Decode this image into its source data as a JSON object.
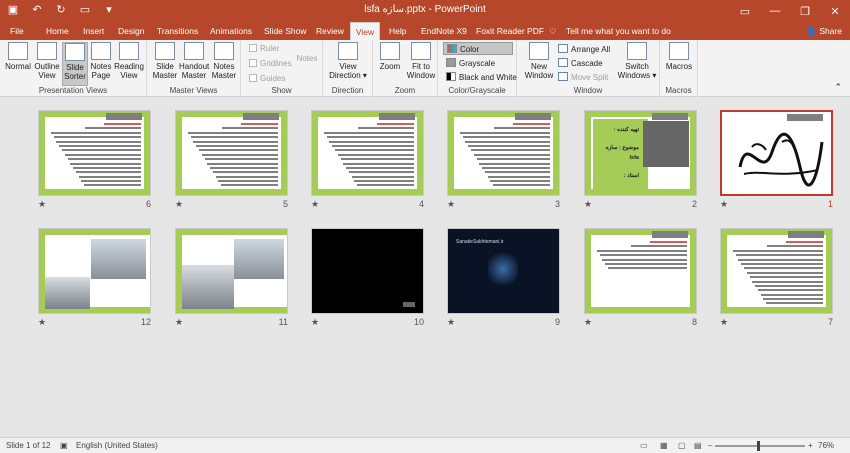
{
  "titlebar": {
    "title": "lsfa سازه.pptx - PowerPoint"
  },
  "tabs": [
    "File",
    "Home",
    "Insert",
    "Design",
    "Transitions",
    "Animations",
    "Slide Show",
    "Review",
    "View",
    "Help",
    "EndNote X9",
    "Foxit Reader PDF",
    "Tell me what you want to do"
  ],
  "share": "Share",
  "ribbon": {
    "presentation_views": {
      "label": "Presentation Views",
      "normal": "Normal",
      "outline": "Outline View",
      "slide_sorter": "Slide Sorter",
      "notes_page": "Notes Page",
      "reading": "Reading View"
    },
    "master_views": {
      "label": "Master Views",
      "slide": "Slide Master",
      "handout": "Handout Master",
      "notes": "Notes Master"
    },
    "show": {
      "label": "Show",
      "ruler": "Ruler",
      "gridlines": "Gridlines",
      "guides": "Guides",
      "notes": "Notes"
    },
    "direction": {
      "label": "Direction",
      "view_direction": "View Direction"
    },
    "zoom": {
      "label": "Zoom",
      "zoom": "Zoom",
      "fit": "Fit to Window"
    },
    "color": {
      "label": "Color/Grayscale",
      "color": "Color",
      "grayscale": "Grayscale",
      "bw": "Black and White"
    },
    "window": {
      "label": "Window",
      "new": "New Window",
      "arrange": "Arrange All",
      "cascade": "Cascade",
      "move_split": "Move Split",
      "switch": "Switch Windows"
    },
    "macros": {
      "label": "Macros",
      "macros": "Macros"
    }
  },
  "slides": [
    {
      "number": "1",
      "kind": "calligraphy"
    },
    {
      "number": "2",
      "kind": "title"
    },
    {
      "number": "3",
      "kind": "text"
    },
    {
      "number": "4",
      "kind": "text"
    },
    {
      "number": "5",
      "kind": "text"
    },
    {
      "number": "6",
      "kind": "text"
    },
    {
      "number": "7",
      "kind": "text"
    },
    {
      "number": "8",
      "kind": "bullets"
    },
    {
      "number": "9",
      "kind": "video"
    },
    {
      "number": "10",
      "kind": "black"
    },
    {
      "number": "11",
      "kind": "photo"
    },
    {
      "number": "12",
      "kind": "photo"
    }
  ],
  "slide2": {
    "line1": "تهیه کننده :",
    "line2": "موضوع : سازه lsfa",
    "line3": "استاد :"
  },
  "slide9_caption": "SanatieSakhtemani.ir",
  "status": {
    "slide": "Slide 1 of 12",
    "language": "English (United States)",
    "zoom": "76%"
  }
}
